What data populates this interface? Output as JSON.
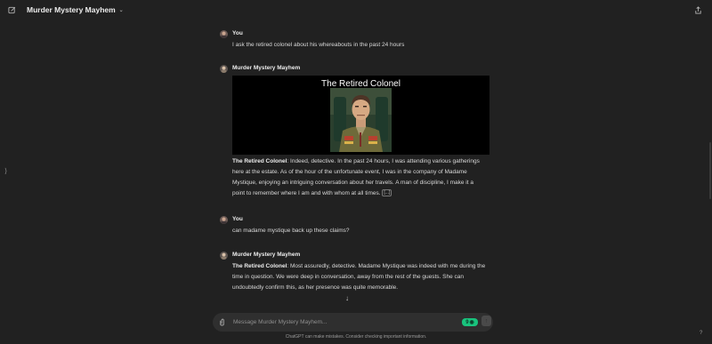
{
  "header": {
    "title": "Murder Mystery Mayhem"
  },
  "messages": [
    {
      "author": "You",
      "text": "I ask the retired colonel about his whereabouts in the past 24 hours"
    },
    {
      "author": "Murder Mystery Mayhem",
      "image_title": "The Retired Colonel",
      "speaker": "The Retired Colonel",
      "text": ": Indeed, detective. In the past 24 hours, I was attending various gatherings here at the estate. As of the hour of the unfortunate event, I was in the company of Madame Mystique, enjoying an intriguing conversation about her travels. A man of discipline, I make it a point to remember where I am and with whom at all times.",
      "more_label": "[...]"
    },
    {
      "author": "You",
      "text": "can madame mystique back up these claims?"
    },
    {
      "author": "Murder Mystery Mayhem",
      "speaker": "The Retired Colonel",
      "text": ": Most assuredly, detective. Madame Mystique was indeed with me during the time in question. We were deep in conversation, away from the rest of the guests. She can undoubtedly confirm this, as her presence was quite memorable."
    }
  ],
  "composer": {
    "placeholder": "Message Murder Mystery Mayhem...",
    "badge_label": "9"
  },
  "footer": {
    "disclaimer": "ChatGPT can make mistakes. Consider checking important information.",
    "help": "?"
  },
  "icons": {
    "new_chat": "edit-icon",
    "share": "share-icon",
    "attach": "paperclip-icon",
    "send": "arrow-up-icon",
    "scroll": "arrow-down-icon"
  },
  "colors": {
    "background": "#212121",
    "composer": "#2f2f2f",
    "badge": "#19c37d"
  }
}
